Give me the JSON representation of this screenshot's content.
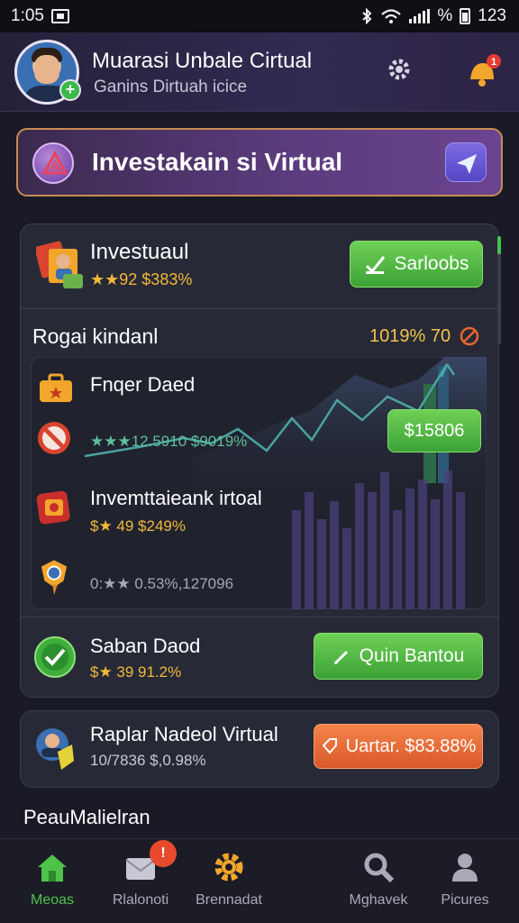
{
  "status_bar": {
    "time": "1:05",
    "battery_text": "123"
  },
  "header": {
    "title": "Muarasi Unbale Cirtual",
    "subtitle": "Ganins Dirtuah icice"
  },
  "banner": {
    "title": "Investakain si Virtual"
  },
  "investment_header": {
    "title": "Investuaul",
    "rating": "★★92 $383%",
    "button_label": "Sarloobs"
  },
  "section": {
    "title": "Rogai kindanl",
    "stat": "1019% 70"
  },
  "rows": [
    {
      "title": "Fnqer Daed",
      "stat": ""
    },
    {
      "title": "",
      "stat": "★★★12.5910 $9019%"
    },
    {
      "title": "Invemttaieank irtoal",
      "stat": "$★ 49 $249%"
    },
    {
      "title": "",
      "stat": "0:★★ 0.53%,127096"
    },
    {
      "title": "Saban Daod",
      "stat": "$★ 39 91.2%"
    }
  ],
  "price_button": {
    "label": "$15806"
  },
  "join_button": {
    "label": "Quin Bantou"
  },
  "card2": {
    "title": "Raplar Nadeol Virtual",
    "stat": "10/7836 $,0.98%",
    "button_label": "Uartar. $83.88%"
  },
  "footer_label": "PeauMalielran",
  "nav": [
    {
      "label": "Meoas",
      "icon": "home-icon",
      "active": true
    },
    {
      "label": "Rlalonoti",
      "icon": "mail-icon",
      "active": false,
      "badge": "!"
    },
    {
      "label": "Brennadat",
      "icon": "gear-icon",
      "active": false
    },
    {
      "label": "Mghavek",
      "icon": "search-icon",
      "active": false
    },
    {
      "label": "Picures",
      "icon": "user-icon",
      "active": false
    }
  ],
  "colors": {
    "accent_green": "#4fc24a",
    "accent_orange": "#e8642f",
    "accent_purple": "#6b4490",
    "rating_gold": "#f2b93b",
    "background": "#1a1a26"
  }
}
